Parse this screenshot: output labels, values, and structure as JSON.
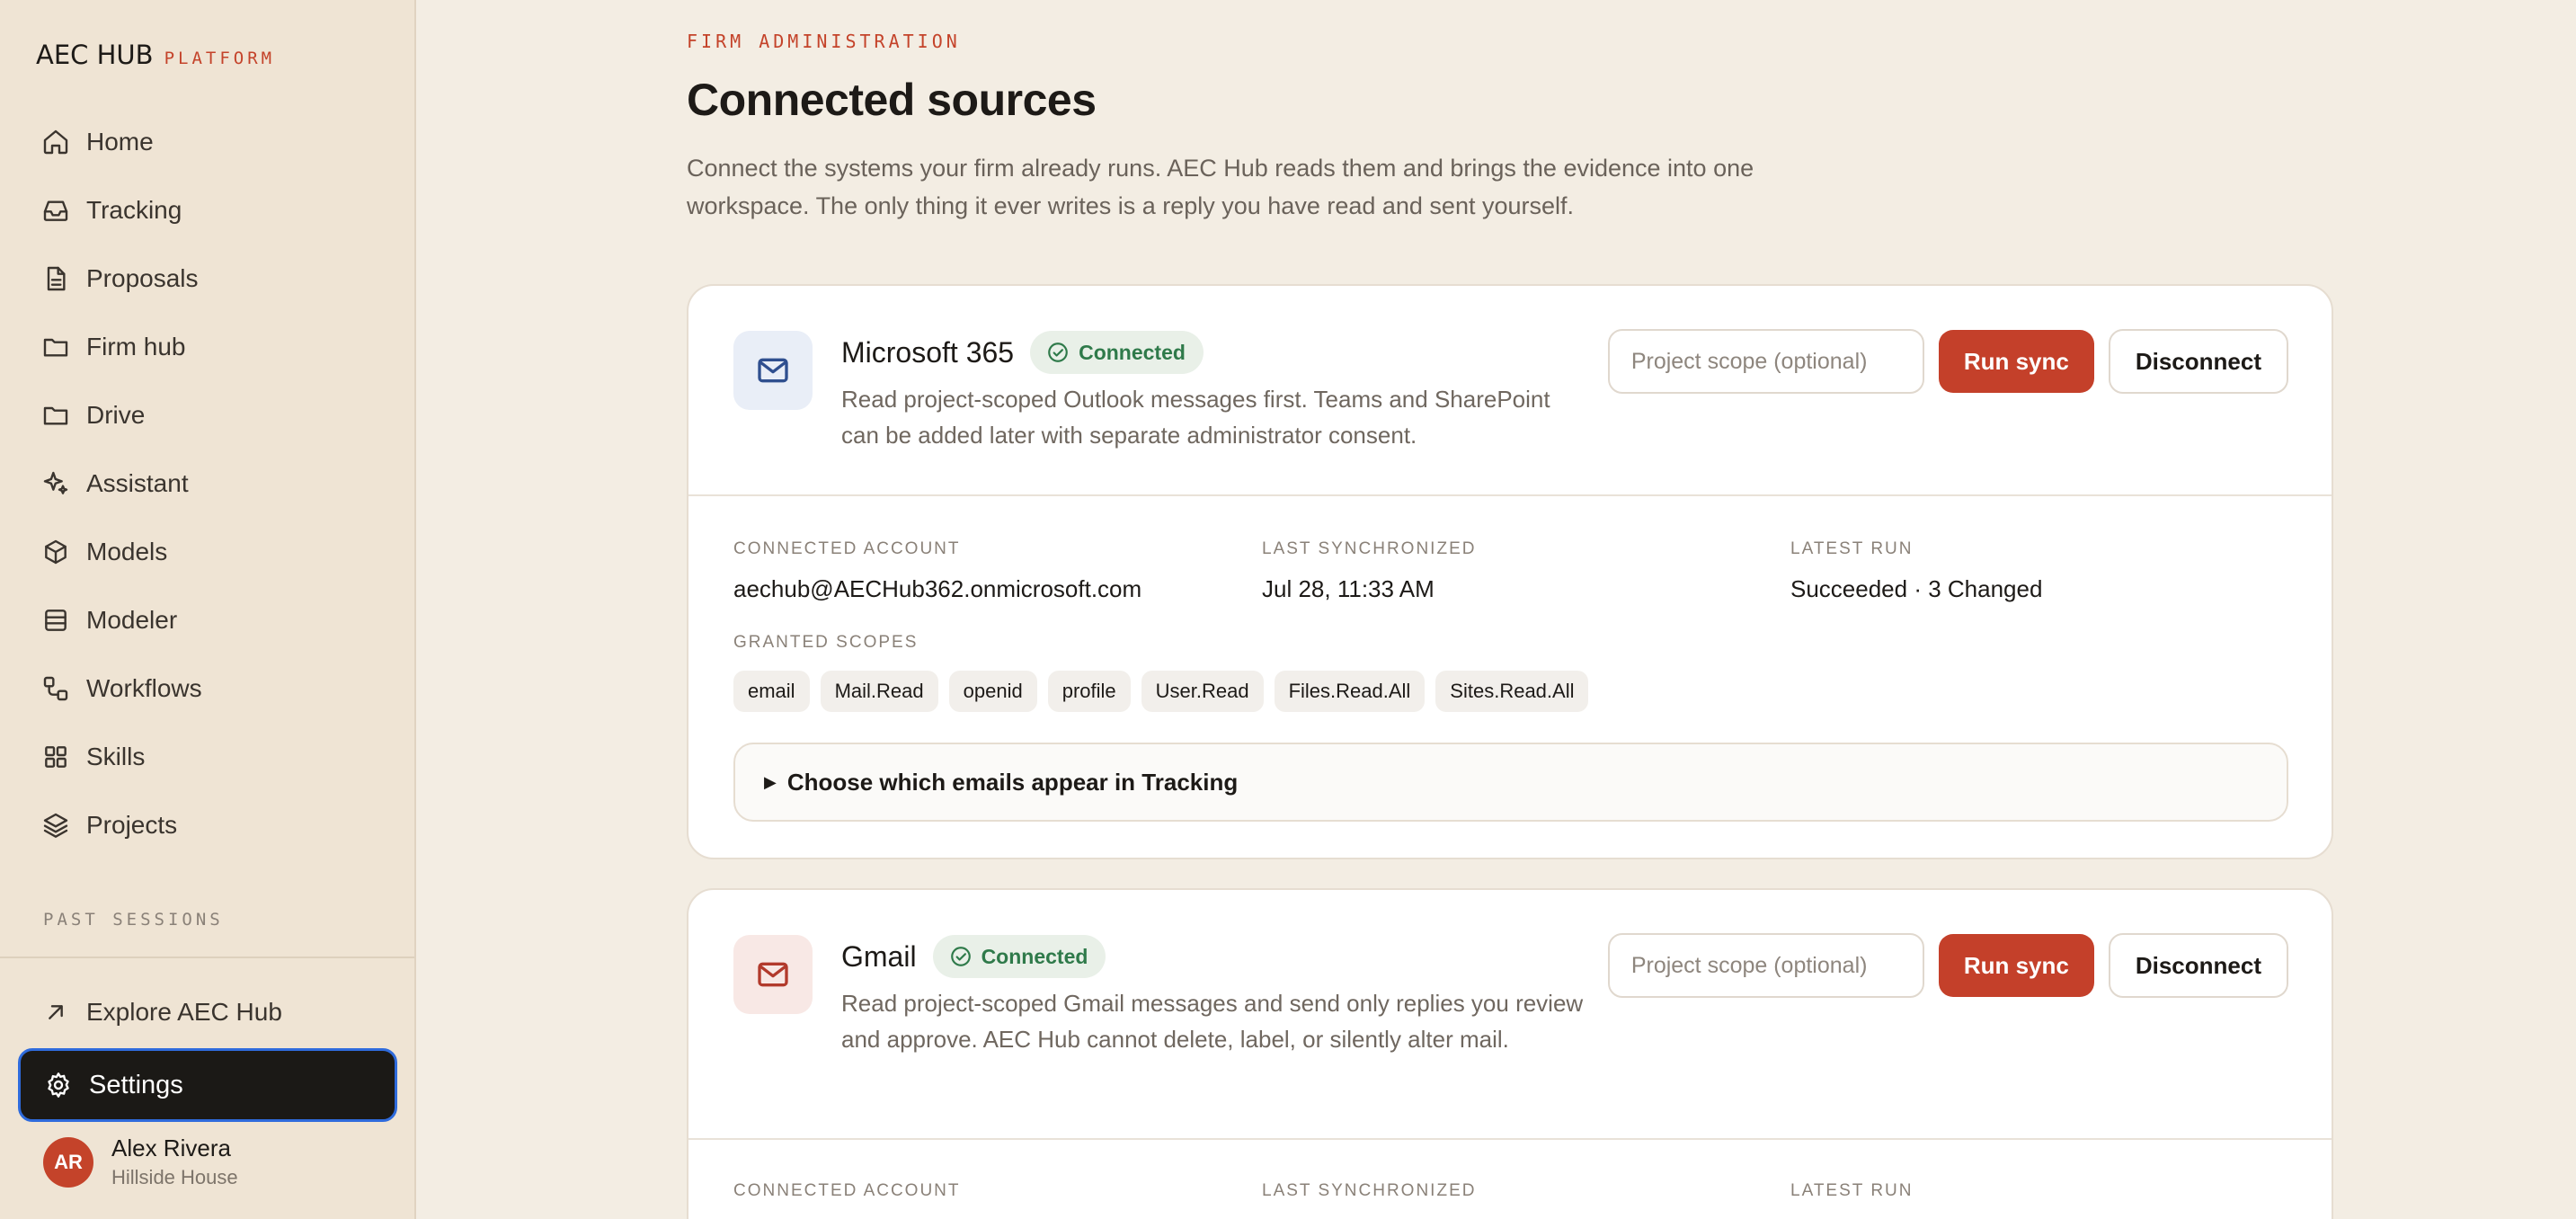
{
  "brand": {
    "name": "AEC HUB",
    "tagline": "PLATFORM"
  },
  "nav": [
    {
      "label": "Home",
      "icon": "home-icon"
    },
    {
      "label": "Tracking",
      "icon": "inbox-icon"
    },
    {
      "label": "Proposals",
      "icon": "document-icon"
    },
    {
      "label": "Firm hub",
      "icon": "folder-icon"
    },
    {
      "label": "Drive",
      "icon": "folder-icon"
    },
    {
      "label": "Assistant",
      "icon": "sparkles-icon"
    },
    {
      "label": "Models",
      "icon": "cube-icon"
    },
    {
      "label": "Modeler",
      "icon": "database-icon"
    },
    {
      "label": "Workflows",
      "icon": "workflow-icon"
    },
    {
      "label": "Skills",
      "icon": "grid-icon"
    },
    {
      "label": "Projects",
      "icon": "layers-icon"
    }
  ],
  "past_sessions_label": "PAST SESSIONS",
  "explore_label": "Explore AEC Hub",
  "settings_label": "Settings",
  "user": {
    "initials": "AR",
    "name": "Alex Rivera",
    "org": "Hillside House"
  },
  "page": {
    "eyebrow": "FIRM ADMINISTRATION",
    "title": "Connected sources",
    "description": "Connect the systems your firm already runs. AEC Hub reads them and brings the evidence into one workspace. The only thing it ever writes is a reply you have read and sent yourself."
  },
  "sources": [
    {
      "name": "Microsoft 365",
      "status": "Connected",
      "description": "Read project-scoped Outlook messages first. Teams and SharePoint can be added later with separate administrator consent.",
      "scope_placeholder": "Project scope (optional)",
      "run_sync_label": "Run sync",
      "disconnect_label": "Disconnect",
      "meta": {
        "account_label": "CONNECTED ACCOUNT",
        "account": "aechub@AECHub362.onmicrosoft.com",
        "synced_label": "LAST SYNCHRONIZED",
        "synced": "Jul 28, 11:33 AM",
        "run_label": "LATEST RUN",
        "run": "Succeeded · 3 Changed"
      },
      "scopes_label": "GRANTED SCOPES",
      "scopes": [
        "email",
        "Mail.Read",
        "openid",
        "profile",
        "User.Read",
        "Files.Read.All",
        "Sites.Read.All"
      ],
      "disclosure": "Choose which emails appear in Tracking"
    },
    {
      "name": "Gmail",
      "status": "Connected",
      "description": "Read project-scoped Gmail messages and send only replies you review and approve. AEC Hub cannot delete, label, or silently alter mail.",
      "scope_placeholder": "Project scope (optional)",
      "run_sync_label": "Run sync",
      "disconnect_label": "Disconnect",
      "meta": {
        "account_label": "CONNECTED ACCOUNT",
        "synced_label": "LAST SYNCHRONIZED",
        "run_label": "LATEST RUN"
      }
    }
  ],
  "colors": {
    "accent": "#c4432a",
    "sidebar_bg": "#efe4d4",
    "page_bg": "#f3ede3",
    "connected_green": "#2f7a4a",
    "settings_bg": "#1b1916",
    "focus_ring": "#2f6bdc"
  }
}
